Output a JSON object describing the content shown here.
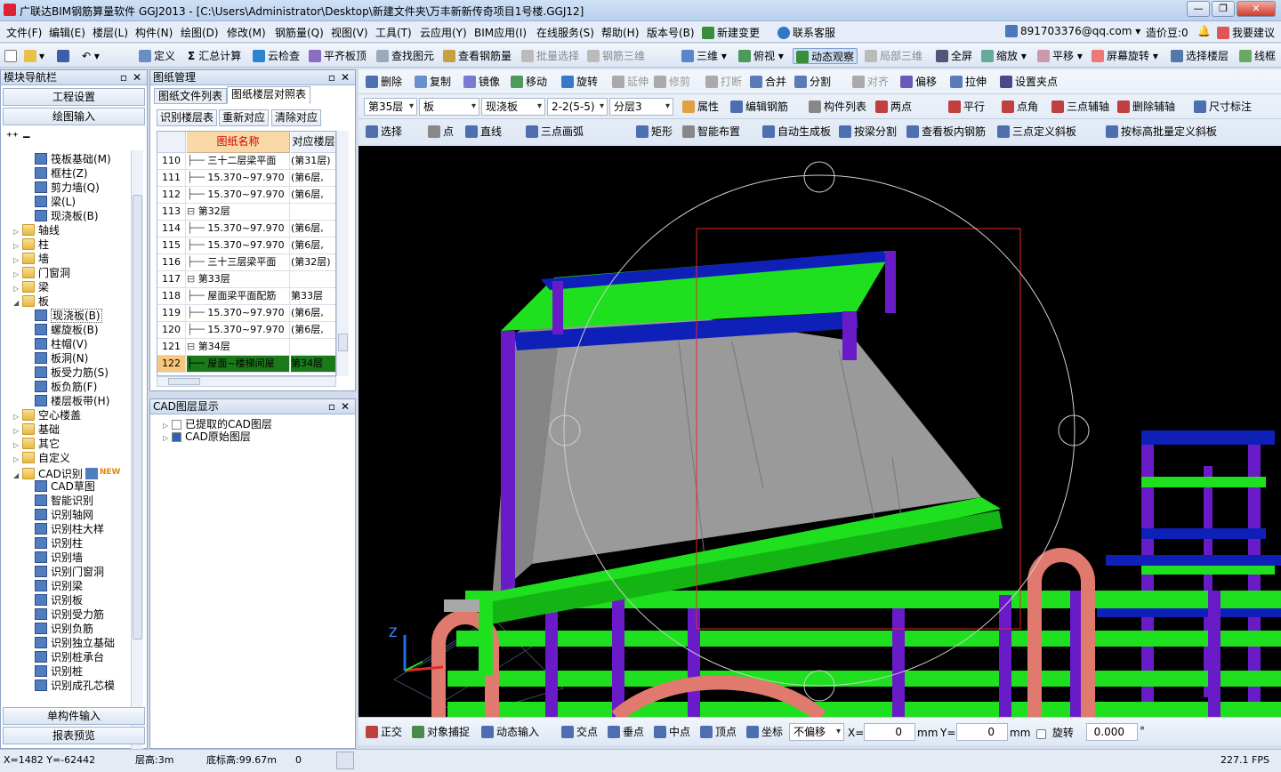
{
  "title": "广联达BIM钢筋算量软件 GGJ2013 - [C:\\Users\\Administrator\\Desktop\\新建文件夹\\万丰新新传奇项目1号楼.GGJ12]",
  "menu": [
    "文件(F)",
    "编辑(E)",
    "楼层(L)",
    "构件(N)",
    "绘图(D)",
    "修改(M)",
    "钢筋量(Q)",
    "视图(V)",
    "工具(T)",
    "云应用(Y)",
    "BIM应用(I)",
    "在线服务(S)",
    "帮助(H)",
    "版本号(B)",
    "新建变更",
    "联系客服"
  ],
  "menu_right": {
    "email": "891703376@qq.com",
    "credit": "造价豆:0",
    "suggest": "我要建议"
  },
  "toolbar1": [
    "定义",
    "汇总计算",
    "云检查",
    "平齐板顶",
    "查找图元",
    "查看钢筋量",
    "批量选择",
    "钢筋三维",
    "三维",
    "俯视",
    "动态观察",
    "局部三维",
    "全屏",
    "缩放",
    "平移",
    "屏幕旋转",
    "选择楼层",
    "线框"
  ],
  "left_panel": {
    "title": "模块导航栏",
    "btn_project": "工程设置",
    "btn_draw": "绘图输入",
    "btn_single": "单构件输入",
    "btn_report": "报表预览",
    "tree": [
      {
        "label": "筏板基础(M)",
        "level": 2,
        "icon": "item"
      },
      {
        "label": "框柱(Z)",
        "level": 2,
        "icon": "item"
      },
      {
        "label": "剪力墙(Q)",
        "level": 2,
        "icon": "item"
      },
      {
        "label": "梁(L)",
        "level": 2,
        "icon": "item"
      },
      {
        "label": "现浇板(B)",
        "level": 2,
        "icon": "item"
      },
      {
        "label": "轴线",
        "level": 1,
        "icon": "folder",
        "exp": "▷"
      },
      {
        "label": "柱",
        "level": 1,
        "icon": "folder",
        "exp": "▷"
      },
      {
        "label": "墙",
        "level": 1,
        "icon": "folder",
        "exp": "▷"
      },
      {
        "label": "门窗洞",
        "level": 1,
        "icon": "folder",
        "exp": "▷"
      },
      {
        "label": "梁",
        "level": 1,
        "icon": "folder",
        "exp": "▷"
      },
      {
        "label": "板",
        "level": 1,
        "icon": "folder",
        "exp": "◢"
      },
      {
        "label": "现浇板(B)",
        "level": 2,
        "icon": "item"
      },
      {
        "label": "螺旋板(B)",
        "level": 2,
        "icon": "item"
      },
      {
        "label": "柱帽(V)",
        "level": 2,
        "icon": "item"
      },
      {
        "label": "板洞(N)",
        "level": 2,
        "icon": "item"
      },
      {
        "label": "板受力筋(S)",
        "level": 2,
        "icon": "item"
      },
      {
        "label": "板负筋(F)",
        "level": 2,
        "icon": "item"
      },
      {
        "label": "楼层板带(H)",
        "level": 2,
        "icon": "item"
      },
      {
        "label": "空心楼盖",
        "level": 1,
        "icon": "folder",
        "exp": "▷"
      },
      {
        "label": "基础",
        "level": 1,
        "icon": "folder",
        "exp": "▷"
      },
      {
        "label": "其它",
        "level": 1,
        "icon": "folder",
        "exp": "▷"
      },
      {
        "label": "自定义",
        "level": 1,
        "icon": "folder",
        "exp": "▷"
      },
      {
        "label": "CAD识别",
        "level": 1,
        "icon": "folder",
        "exp": "◢",
        "badge": "NEW"
      },
      {
        "label": "CAD草图",
        "level": 2,
        "icon": "item"
      },
      {
        "label": "智能识别",
        "level": 2,
        "icon": "item"
      },
      {
        "label": "识别轴网",
        "level": 2,
        "icon": "item"
      },
      {
        "label": "识别柱大样",
        "level": 2,
        "icon": "item"
      },
      {
        "label": "识别柱",
        "level": 2,
        "icon": "item"
      },
      {
        "label": "识别墙",
        "level": 2,
        "icon": "item"
      },
      {
        "label": "识别门窗洞",
        "level": 2,
        "icon": "item"
      },
      {
        "label": "识别梁",
        "level": 2,
        "icon": "item"
      },
      {
        "label": "识别板",
        "level": 2,
        "icon": "item"
      },
      {
        "label": "识别受力筋",
        "level": 2,
        "icon": "item"
      },
      {
        "label": "识别负筋",
        "level": 2,
        "icon": "item"
      },
      {
        "label": "识别独立基础",
        "level": 2,
        "icon": "item"
      },
      {
        "label": "识别桩承台",
        "level": 2,
        "icon": "item"
      },
      {
        "label": "识别桩",
        "level": 2,
        "icon": "item"
      },
      {
        "label": "识别成孔芯模",
        "level": 2,
        "icon": "item"
      }
    ]
  },
  "drawing_panel": {
    "title": "图纸管理",
    "tabs": [
      "图纸文件列表",
      "图纸楼层对照表"
    ],
    "buttons": [
      "识别楼层表",
      "重新对应",
      "清除对应"
    ],
    "col_name": "图纸名称",
    "col_floor": "对应楼层",
    "rows": [
      {
        "n": "110",
        "name": "三十二层梁平面",
        "floor": "(第31层)",
        "indent": 2
      },
      {
        "n": "111",
        "name": "15.370~97.970",
        "floor": "(第6层,",
        "indent": 2
      },
      {
        "n": "112",
        "name": "15.370~97.970",
        "floor": "(第6层,",
        "indent": 2
      },
      {
        "n": "113",
        "name": "第32层",
        "floor": "",
        "indent": 1,
        "group": true
      },
      {
        "n": "114",
        "name": "15.370~97.970",
        "floor": "(第6层,",
        "indent": 2
      },
      {
        "n": "115",
        "name": "15.370~97.970",
        "floor": "(第6层,",
        "indent": 2
      },
      {
        "n": "116",
        "name": "三十三层梁平面",
        "floor": "(第32层)",
        "indent": 2
      },
      {
        "n": "117",
        "name": "第33层",
        "floor": "",
        "indent": 1,
        "group": true
      },
      {
        "n": "118",
        "name": "屋面梁平面配筋",
        "floor": "第33层",
        "indent": 2
      },
      {
        "n": "119",
        "name": "15.370~97.970",
        "floor": "(第6层,",
        "indent": 2
      },
      {
        "n": "120",
        "name": "15.370~97.970",
        "floor": "(第6层,",
        "indent": 2
      },
      {
        "n": "121",
        "name": "第34层",
        "floor": "",
        "indent": 1,
        "group": true
      },
      {
        "n": "122",
        "name": "屋面~楼梯间屋",
        "floor": "第34层",
        "indent": 2,
        "selected": true
      }
    ]
  },
  "cad_panel": {
    "title": "CAD图层显示",
    "items": [
      "已提取的CAD图层",
      "CAD原始图层"
    ]
  },
  "toolbar2": [
    "删除",
    "复制",
    "镜像",
    "移动",
    "旋转",
    "延伸",
    "修剪",
    "打断",
    "合并",
    "分割",
    "对齐",
    "偏移",
    "拉伸",
    "设置夹点"
  ],
  "toolbar3": {
    "floor": "第35层",
    "type": "板",
    "subtype": "现浇板",
    "name": "2-2(5-5)",
    "layer": "分层3",
    "items": [
      "属性",
      "编辑钢筋",
      "构件列表",
      "两点",
      "平行",
      "点角",
      "三点辅轴",
      "删除辅轴",
      "尺寸标注"
    ]
  },
  "toolbar4": [
    "选择",
    "点",
    "直线",
    "三点画弧",
    "矩形",
    "智能布置",
    "自动生成板",
    "按梁分割",
    "查看板内钢筋",
    "三点定义斜板",
    "按标高批量定义斜板"
  ],
  "bottom_tools": {
    "items": [
      "正交",
      "对象捕捉",
      "动态输入",
      "交点",
      "垂点",
      "中点",
      "顶点",
      "坐标"
    ],
    "offset_mode": "不偏移",
    "x_label": "X=",
    "x_value": "0",
    "y_label": "Y=",
    "y_value": "0",
    "unit": "mm",
    "rotate_label": "旋转",
    "rotate_value": "0.000"
  },
  "axis_label": "Z",
  "status": {
    "coords": "X=1482 Y=-62442",
    "floor_height": "层高:3m",
    "base_elev": "底标高:99.67m",
    "zero": "0",
    "fps": "227.1 FPS"
  },
  "colors": {
    "beam_green": "#1ee01e",
    "beam_blue": "#0f20b8",
    "column_purple": "#6a1bc8",
    "slab_gray": "#9a9a9a",
    "arch": "#e07a6e"
  }
}
